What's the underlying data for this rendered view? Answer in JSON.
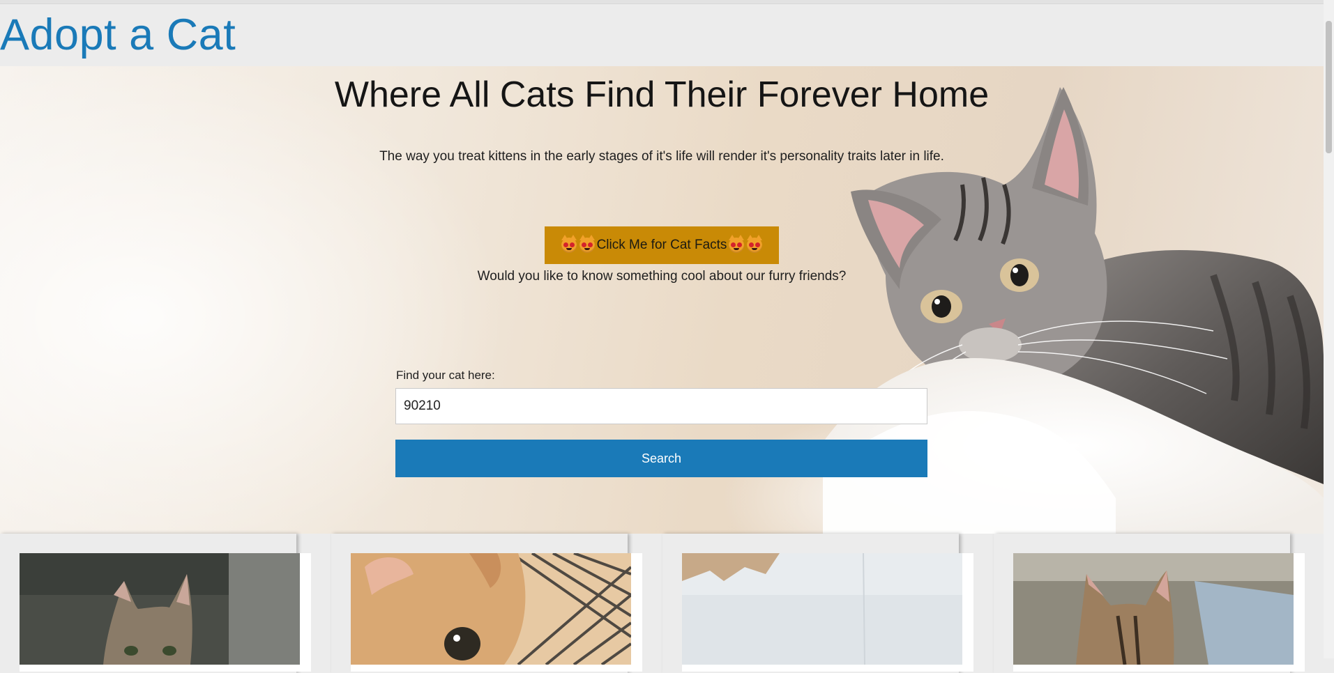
{
  "site": {
    "title": "Adopt a Cat"
  },
  "hero": {
    "heading": "Where All Cats Find Their Forever Home",
    "subtitle": "The way you treat kittens in the early stages of it's life will render it's personality traits later in life.",
    "facts_button_label": "Click Me for Cat Facts",
    "facts_question": "Would you like to know something cool about our furry friends?",
    "button_color": "#c98a06"
  },
  "search": {
    "label": "Find your cat here:",
    "value": "90210",
    "button_label": "Search",
    "button_color": "#1a7ab8"
  },
  "cards": [
    {
      "icon": "kitten-photo-tabby"
    },
    {
      "icon": "kitten-photo-orange"
    },
    {
      "icon": "kitten-photo-white"
    },
    {
      "icon": "kitten-photo-tabby-2"
    }
  ],
  "colors": {
    "brand": "#1a7ab8",
    "background": "#ececec"
  }
}
